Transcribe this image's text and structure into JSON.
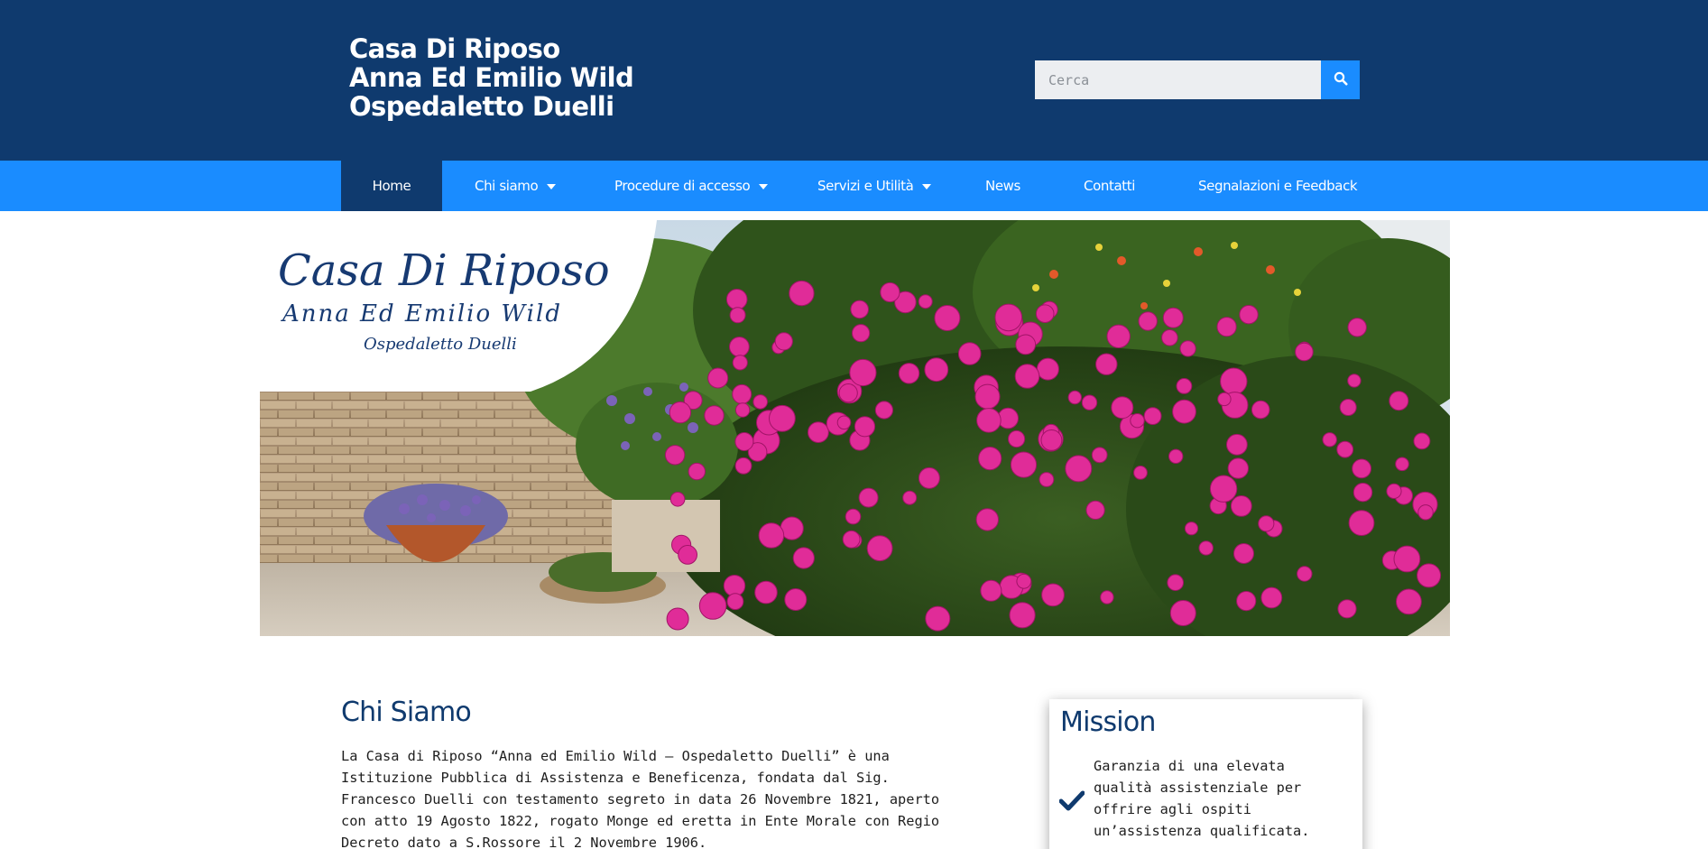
{
  "header": {
    "title_lines": [
      "Casa Di Riposo",
      "Anna Ed Emilio Wild",
      "Ospedaletto Duelli"
    ],
    "search": {
      "placeholder": "Cerca",
      "value": "",
      "icon": "search-icon"
    },
    "colors": {
      "header_bg": "#0f3a6e",
      "accent": "#1a8cff"
    }
  },
  "nav": {
    "items": [
      {
        "label": "Home",
        "active": true,
        "dropdown": false
      },
      {
        "label": "Chi siamo",
        "active": false,
        "dropdown": true
      },
      {
        "label": "Procedure di accesso",
        "active": false,
        "dropdown": true
      },
      {
        "label": "Servizi e Utilità",
        "active": false,
        "dropdown": true
      },
      {
        "label": "News",
        "active": false,
        "dropdown": false
      },
      {
        "label": "Contatti",
        "active": false,
        "dropdown": false
      },
      {
        "label": "Segnalazioni e Feedback",
        "active": false,
        "dropdown": false
      }
    ]
  },
  "banner": {
    "logo_line1": "Casa Di Riposo",
    "logo_line2": "Anna Ed Emilio Wild",
    "logo_line3": "Ospedaletto Duelli"
  },
  "chi_siamo": {
    "title": "Chi Siamo",
    "paragraph_lines": [
      "La Casa di Riposo “Anna ed Emilio Wild – Ospedaletto Duelli” è una",
      "Istituzione Pubblica di Assistenza e Beneficenza, fondata dal Sig.",
      "Francesco Duelli con testamento segreto in data 26 Novembre 1821, aperto",
      "con atto 19 Agosto 1822, rogato Monge ed eretta in Ente Morale con Regio",
      "Decreto dato a S.Rossore il 2 Novembre 1906."
    ]
  },
  "mission": {
    "title": "Mission",
    "icon": "check-icon",
    "text_lines": [
      "Garanzia di una elevata",
      "qualità assistenziale per",
      "offrire agli ospiti",
      "un’assistenza qualificata."
    ]
  }
}
